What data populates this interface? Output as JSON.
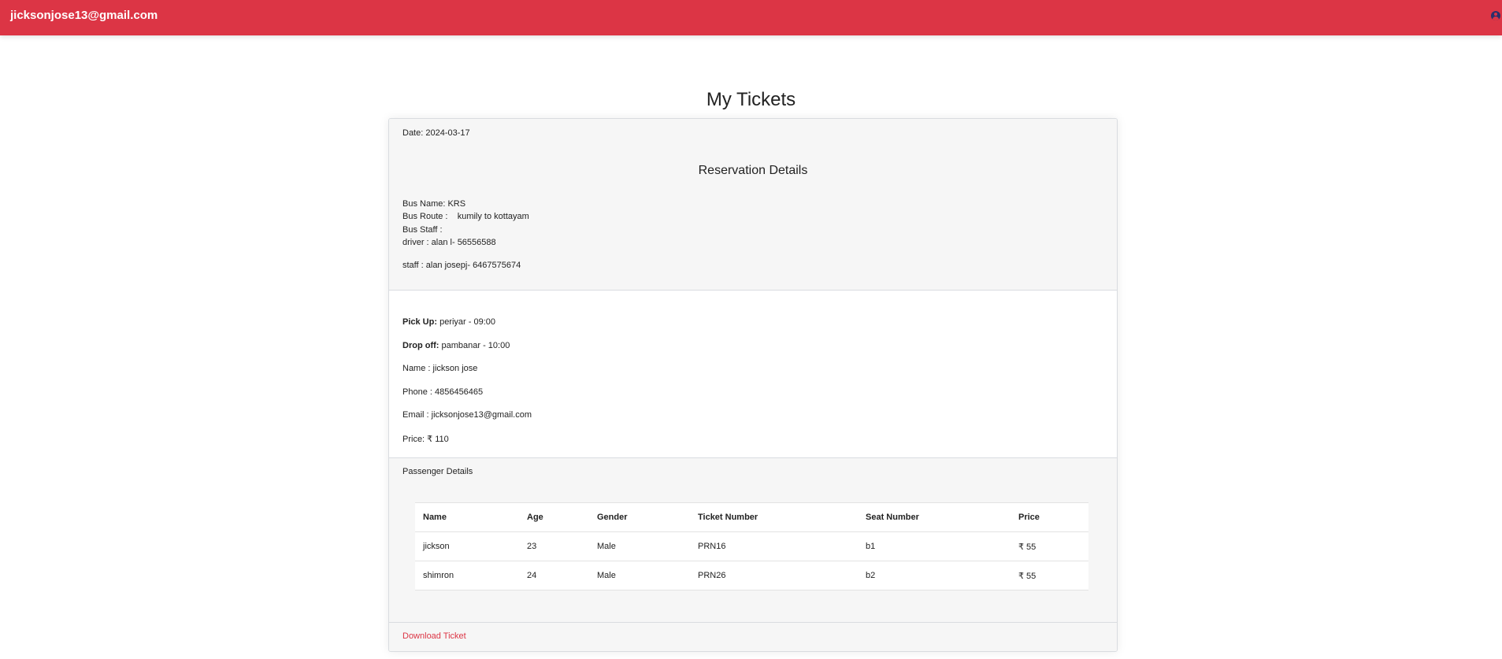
{
  "header": {
    "email": "jicksonjose13@gmail.com",
    "user_icon": "user-circle-icon"
  },
  "page": {
    "title": "My Tickets"
  },
  "ticket": {
    "date": "Date: 2024-03-17",
    "reservation_title": "Reservation Details",
    "bus_name": "Bus Name: KRS",
    "bus_route": "Bus Route :    kumily to kottayam",
    "bus_staff": "Bus Staff :",
    "driver": "driver : alan l- 56556588",
    "staff": "staff : alan josepj- 6467575674",
    "pickup_label": "Pick Up:",
    "pickup_value": " periyar - 09:00",
    "dropoff_label": "Drop off:",
    "dropoff_value": " pambanar - 10:00",
    "name": "Name : jickson jose",
    "phone": "Phone : 4856456465",
    "email": "Email : jicksonjose13@gmail.com",
    "price": "Price: ₹ 110",
    "passenger_heading": "Passenger Details",
    "download_label": "Download Ticket"
  },
  "passengers": {
    "columns": [
      "Name",
      "Age",
      "Gender",
      "Ticket Number",
      "Seat Number",
      "Price"
    ],
    "rows": [
      [
        "jickson",
        "23",
        "Male",
        "PRN16",
        "b1",
        "₹ 55"
      ],
      [
        "shimron",
        "24",
        "Male",
        "PRN26",
        "b2",
        "₹ 55"
      ]
    ]
  },
  "colors": {
    "accent": "#dc3545"
  }
}
